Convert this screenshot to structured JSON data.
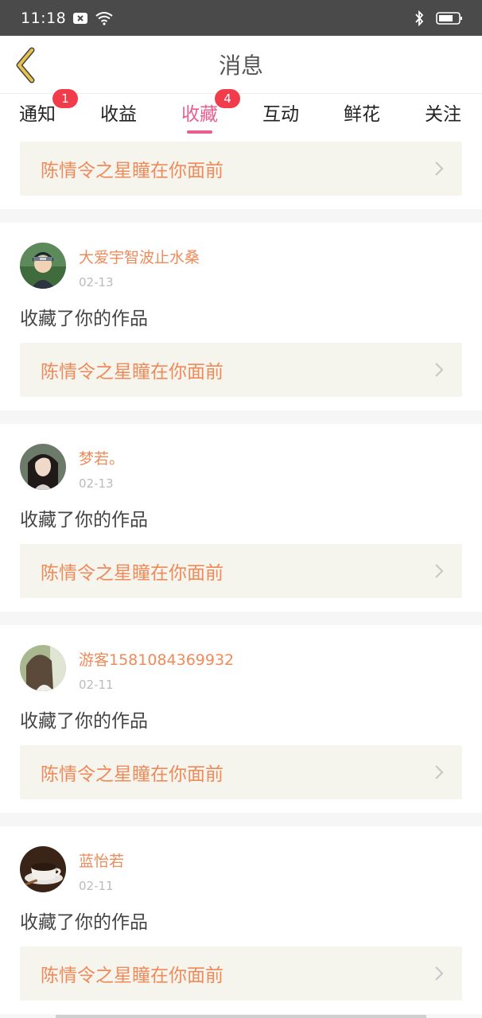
{
  "status_bar": {
    "time": "11:18"
  },
  "header": {
    "title": "消息"
  },
  "tabs": [
    {
      "label": "通知",
      "badge": "1"
    },
    {
      "label": "收益",
      "badge": ""
    },
    {
      "label": "收藏",
      "badge": "4",
      "active": true
    },
    {
      "label": "互动",
      "badge": ""
    },
    {
      "label": "鲜花",
      "badge": ""
    },
    {
      "label": "关注",
      "badge": ""
    }
  ],
  "first_card": {
    "work_title": "陈情令之星瞳在你面前"
  },
  "items": [
    {
      "username": "大爱宇智波止水桑",
      "date": "02-13",
      "action": "收藏了你的作品",
      "work_title": "陈情令之星瞳在你面前",
      "avatar_icon": "ninja-avatar"
    },
    {
      "username": "梦若。",
      "date": "02-13",
      "action": "收藏了你的作品",
      "work_title": "陈情令之星瞳在你面前",
      "avatar_icon": "woman-avatar"
    },
    {
      "username": "游客1581084369932",
      "date": "02-11",
      "action": "收藏了你的作品",
      "work_title": "陈情令之星瞳在你面前",
      "avatar_icon": "girl-hair-avatar"
    },
    {
      "username": "蓝怡若",
      "date": "02-11",
      "action": "收藏了你的作品",
      "work_title": "陈情令之星瞳在你面前",
      "avatar_icon": "coffee-avatar"
    }
  ],
  "colors": {
    "accent": "#ea5d8f",
    "username": "#ef8a5a",
    "badge": "#f13c4b",
    "back_arrow": "#d9b23a"
  }
}
